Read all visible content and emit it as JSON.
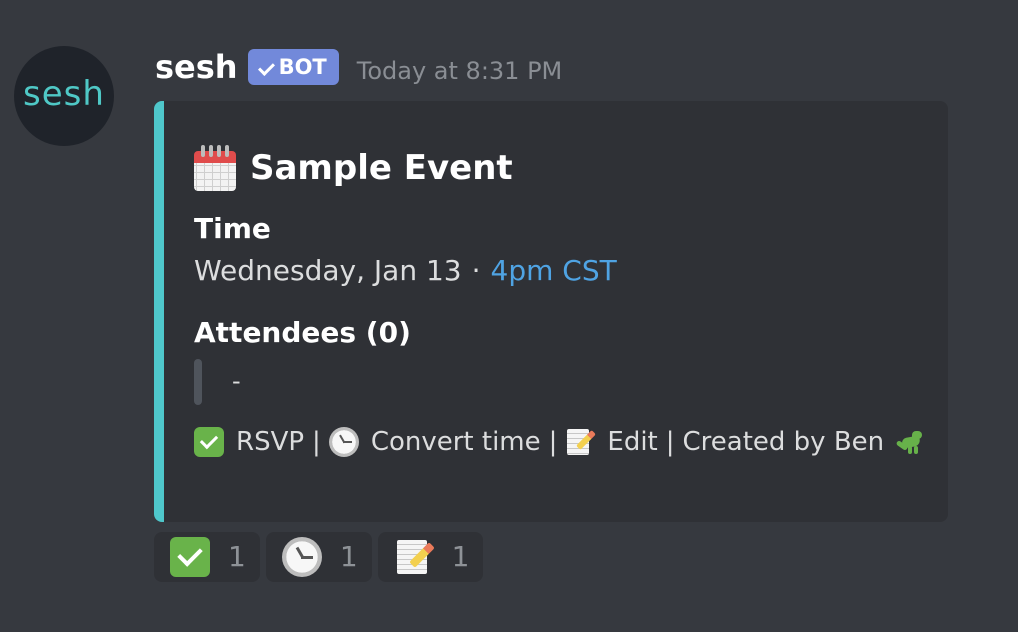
{
  "message": {
    "avatar_text": "sesh",
    "username": "sesh",
    "badge_label": "BOT",
    "timestamp": "Today at 8:31 PM"
  },
  "embed": {
    "accent_color": "#4fc7cb",
    "title": "Sample Event",
    "fields": {
      "time": {
        "name": "Time",
        "value_prefix": "Wednesday, Jan 13",
        "separator": "·",
        "link_text": "4pm CST"
      },
      "attendees": {
        "name": "Attendees (0)",
        "value": "-"
      }
    },
    "footer": {
      "rsvp_label": "RSVP",
      "convert_time_label": "Convert time",
      "edit_label": "Edit",
      "created_by": "Created by Ben",
      "separator": "|"
    }
  },
  "reactions": [
    {
      "icon": "check-mark-button-icon",
      "count": "1"
    },
    {
      "icon": "clock-icon",
      "count": "1"
    },
    {
      "icon": "memo-icon",
      "count": "1"
    }
  ]
}
